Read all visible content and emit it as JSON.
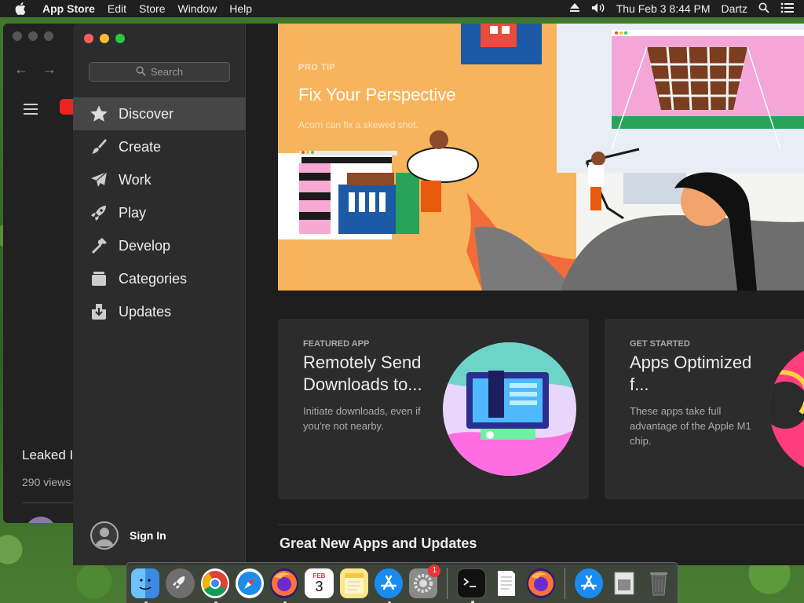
{
  "menubar": {
    "app_name": "App Store",
    "menus": [
      "Edit",
      "Store",
      "Window",
      "Help"
    ],
    "datetime": "Thu Feb 3  8:44 PM",
    "user": "Dartz"
  },
  "bg_window": {
    "video_title": "Leaked I",
    "video_views": "290 views"
  },
  "sidebar": {
    "search_placeholder": "Search",
    "items": [
      {
        "label": "Discover",
        "icon": "star-icon",
        "active": true
      },
      {
        "label": "Create",
        "icon": "brush-icon"
      },
      {
        "label": "Work",
        "icon": "paper-plane-icon"
      },
      {
        "label": "Play",
        "icon": "rocket-icon"
      },
      {
        "label": "Develop",
        "icon": "hammer-icon"
      },
      {
        "label": "Categories",
        "icon": "stack-icon"
      },
      {
        "label": "Updates",
        "icon": "download-icon"
      }
    ],
    "sign_in": "Sign In"
  },
  "hero": {
    "eyebrow": "PRO TIP",
    "title": "Fix Your Perspective",
    "subtitle": "Acorn can fix a skewed shot."
  },
  "cards": [
    {
      "eyebrow": "FEATURED APP",
      "title": "Remotely Send Downloads to...",
      "description": "Initiate downloads, even if you're not nearby."
    },
    {
      "eyebrow": "GET STARTED",
      "title": "Apps Optimized f...",
      "description": "These apps take full advantage of the Apple M1 chip."
    }
  ],
  "section_title": "Great New Apps and Updates",
  "dock": {
    "calendar_month": "FEB",
    "calendar_day": "3",
    "prefs_badge": "1",
    "apps": [
      "finder-icon",
      "launchpad-icon",
      "chrome-icon",
      "safari-icon",
      "firefox-icon",
      "calendar-icon",
      "notes-icon",
      "app-store-icon",
      "system-preferences-icon",
      "terminal-icon",
      "textedit-icon",
      "firefox-icon",
      "app-store-icon",
      "preview-icon",
      "trash-icon"
    ]
  }
}
